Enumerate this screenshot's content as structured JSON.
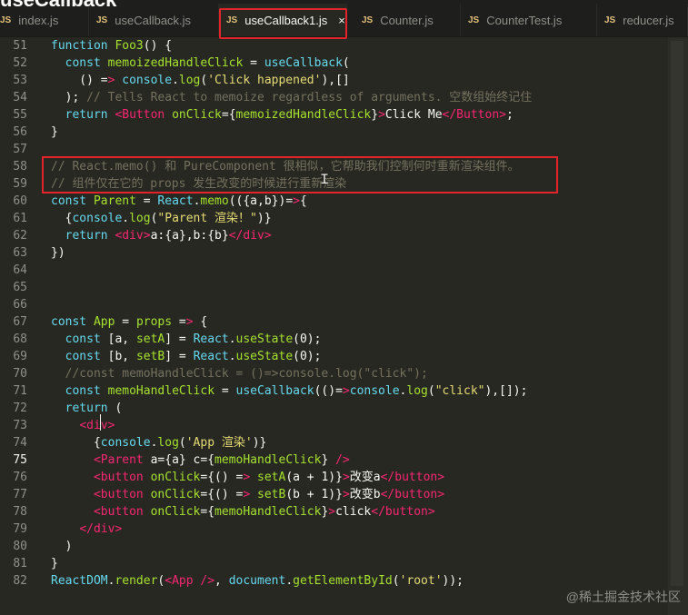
{
  "page_title": "useCallback",
  "tabs": [
    {
      "icon": "JS",
      "label": "index.js",
      "active": false
    },
    {
      "icon": "JS",
      "label": "useCallback.js",
      "active": false
    },
    {
      "icon": "JS",
      "label": "useCallback1.js",
      "active": true
    },
    {
      "icon": "JS",
      "label": "Counter.js",
      "active": false
    },
    {
      "icon": "JS",
      "label": "CounterTest.js",
      "active": false
    },
    {
      "icon": "JS",
      "label": "reducer.js",
      "active": false
    }
  ],
  "close_label": "×",
  "line_numbers": [
    "51",
    "52",
    "53",
    "54",
    "55",
    "56",
    "57",
    "58",
    "59",
    "60",
    "61",
    "62",
    "63",
    "64",
    "65",
    "66",
    "67",
    "68",
    "69",
    "70",
    "71",
    "72",
    "73",
    "74",
    "75",
    "76",
    "77",
    "78",
    "79",
    "80",
    "81",
    "82"
  ],
  "code_lines": [
    "function Foo3() {",
    "  const memoizedHandleClick = useCallback(",
    "    () => console.log('Click happened'),[]",
    "  ); // Tells React to memoize regardless of arguments. 空数组始终记住",
    "  return <Button onClick={memoizedHandleClick}>Click Me</Button>;",
    "}",
    "",
    "// React.memo() 和 PureComponent 很相似，它帮助我们控制何时重新渲染组件。",
    "// 组件仅在它的 props 发生改变的时候进行重新渲染",
    "const Parent = React.memo(({a,b})=>{",
    "  {console.log(\"Parent 渲染！\")}",
    "  return <div>a:{a},b:{b}</div>",
    "})",
    "",
    "",
    "",
    "const App = props => {",
    "  const [a, setA] = React.useState(0);",
    "  const [b, setB] = React.useState(0);",
    "  //const memoHandleClick = ()=>console.log(\"click\");",
    "  const memoHandleClick = useCallback(()=>console.log(\"click\"),[]);",
    "  return (",
    "    <div>",
    "      {console.log('App 渲染')}",
    "      <Parent a={a} c={memoHandleClick} />",
    "      <button onClick={() => setA(a + 1)}>改变a</button>",
    "      <button onClick={() => setB(b + 1)}>改变b</button>",
    "      <button onClick={memoHandleClick}>click</button>",
    "    </div>",
    "  )",
    "}",
    "ReactDOM.render(<App />, document.getElementById('root'));"
  ],
  "watermark": "@稀土掘金技术社区",
  "colors": {
    "background": "#272822",
    "highlight_box": "#e5232b",
    "keyword": "#66d9ef",
    "function": "#a6e22e",
    "string": "#e6db74",
    "comment": "#75715e",
    "tag": "#f92672"
  },
  "icons": [
    "js-file-icon",
    "close-icon"
  ]
}
